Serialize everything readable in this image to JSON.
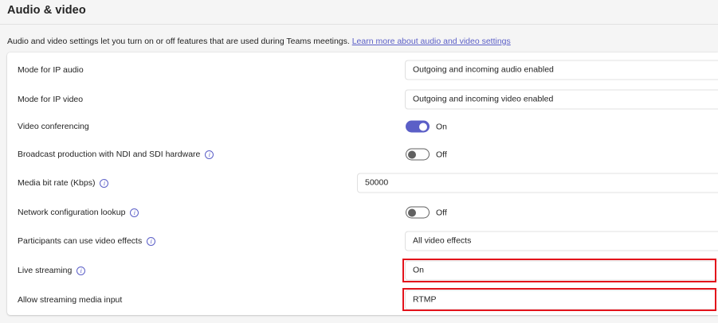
{
  "section": {
    "title": "Audio & video",
    "description": "Audio and video settings let you turn on or off features that are used during Teams meetings.",
    "learn_more_link": "Learn more about audio and video settings"
  },
  "settings": {
    "ip_audio": {
      "label": "Mode for IP audio",
      "value": "Outgoing and incoming audio enabled"
    },
    "ip_video": {
      "label": "Mode for IP video",
      "value": "Outgoing and incoming video enabled"
    },
    "video_conferencing": {
      "label": "Video conferencing",
      "state": "On"
    },
    "broadcast_production": {
      "label": "Broadcast production with NDI and SDI hardware",
      "state": "Off"
    },
    "media_bit_rate": {
      "label": "Media bit rate (Kbps)",
      "value": "50000"
    },
    "network_config_lookup": {
      "label": "Network configuration lookup",
      "state": "Off"
    },
    "video_effects": {
      "label": "Participants can use video effects",
      "value": "All video effects"
    },
    "live_streaming": {
      "label": "Live streaming",
      "value": "On"
    },
    "streaming_media_input": {
      "label": "Allow streaming media input",
      "value": "RTMP"
    }
  },
  "icons": {
    "info": "info-icon"
  },
  "colors": {
    "accent": "#5b5fc7",
    "highlight": "#e3131b",
    "background": "#f5f5f5"
  }
}
